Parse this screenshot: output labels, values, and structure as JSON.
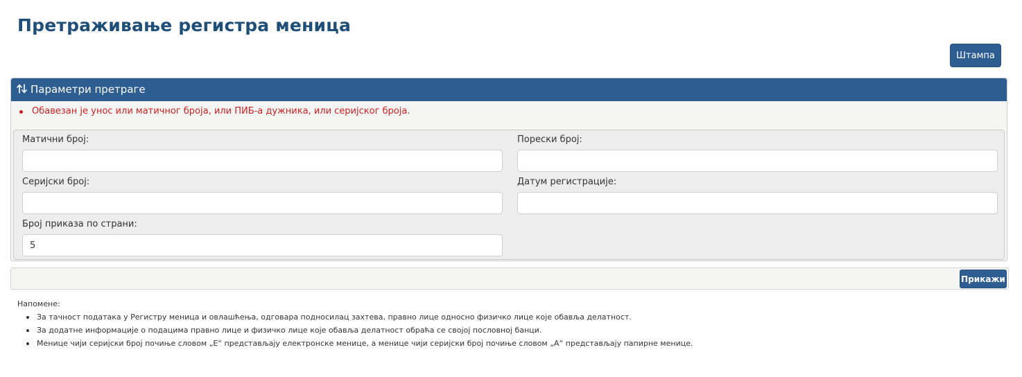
{
  "page": {
    "title": "Претраживање регистра меница"
  },
  "toolbar": {
    "print_label": "Штампа"
  },
  "panel": {
    "header": "Параметри претраге",
    "header_icon": "sort-arrows-icon",
    "error": "Обавезан је унос или матичног броја, или ПИБ-а дужника, или серијског броја."
  },
  "form": {
    "id_number": {
      "label": "Матични број:",
      "value": ""
    },
    "tax_number": {
      "label": "Порески број:",
      "value": ""
    },
    "serial_number": {
      "label": "Серијски број:",
      "value": ""
    },
    "registration_date": {
      "label": "Датум регистрације:",
      "value": ""
    },
    "page_size": {
      "label": "Број приказа по страни:",
      "value": "5"
    }
  },
  "actions": {
    "show_label": "Прикажи"
  },
  "notes": {
    "title": "Напомене:",
    "items": [
      "За тачност података у Регистру меница и овлашћења, одговара подносилац захтева, правно лице односно физичко лице које обавља делатност.",
      "За додатне информације о подацима правно лице и физичко лице које обавља делатност обраћа се својој пословној банци.",
      "Менице чији серијски број почиње словом „Е“ представљају електронске менице, а менице чији серијски број почиње словом „А“ представљају папирне менице."
    ]
  },
  "colors": {
    "primary": "#2d5d91",
    "title": "#1f4e79",
    "error": "#d21f1f"
  }
}
